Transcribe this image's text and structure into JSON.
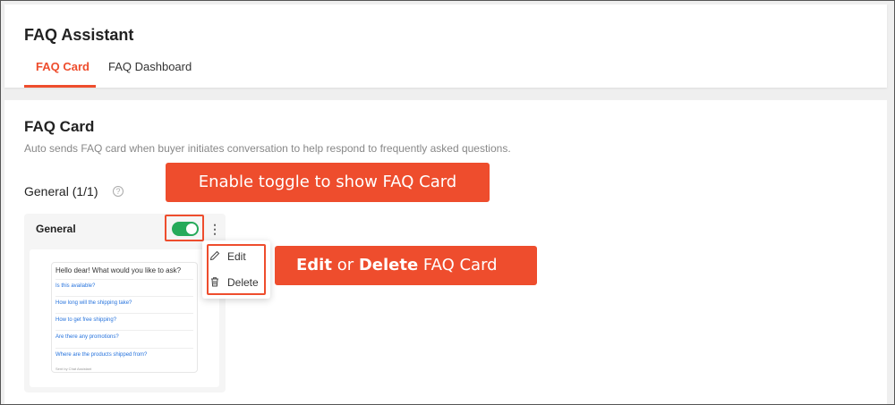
{
  "header": {
    "title": "FAQ Assistant",
    "tabs": [
      {
        "label": "FAQ Card",
        "active": true
      },
      {
        "label": "FAQ Dashboard",
        "active": false
      }
    ]
  },
  "main": {
    "section_title": "FAQ Card",
    "description": "Auto sends FAQ card when buyer initiates conversation to help respond to frequently asked questions.",
    "group_title": "General (1/1)",
    "card": {
      "label": "General",
      "toggle_on": true,
      "preview": {
        "greeting": "Hello dear! What would you like to ask?",
        "questions": [
          "Is this available?",
          "How long will the shipping take?",
          "How to get free shipping?",
          "Are there any promotions?",
          "Where are the products shipped from?"
        ],
        "footer": "Sent by Chat Assistant"
      }
    },
    "menu": {
      "edit_label": "Edit",
      "delete_label": "Delete"
    }
  },
  "callouts": {
    "toggle": "Enable toggle to show FAQ Card",
    "edit_word": "Edit",
    "or_word": " or ",
    "delete_word": "Delete",
    "suffix": " FAQ Card"
  },
  "colors": {
    "accent": "#ee4d2d",
    "toggle": "#26aa5a",
    "link": "#2673dd"
  }
}
